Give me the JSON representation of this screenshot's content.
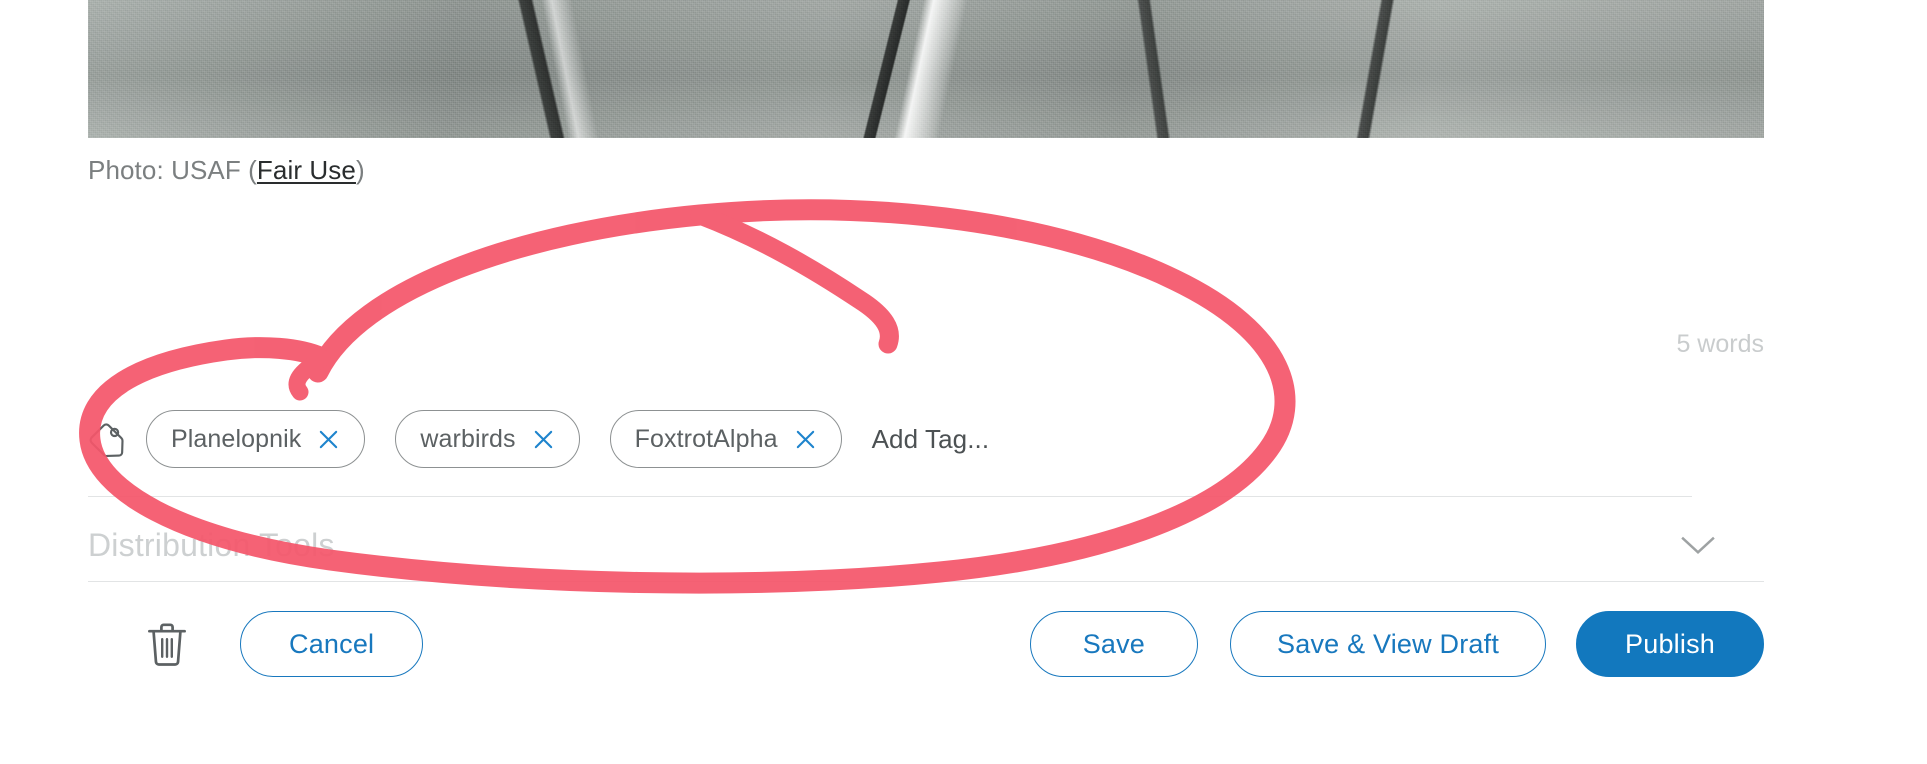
{
  "media": {
    "alt_description": "Close-up photograph of a concrete runway apron with diagonal expansion joints",
    "caption_prefix": "Photo: USAF (",
    "caption_link": "Fair Use",
    "caption_suffix": ")"
  },
  "editor": {
    "word_count": "5 words"
  },
  "tags": {
    "icon": "tag-icon",
    "items": [
      {
        "label": "Planelopnik",
        "remove_icon": "close-icon"
      },
      {
        "label": "warbirds",
        "remove_icon": "close-icon"
      },
      {
        "label": "FoxtrotAlpha",
        "remove_icon": "close-icon"
      }
    ],
    "add_placeholder": "Add Tag..."
  },
  "distribution": {
    "title": "Distribution Tools",
    "toggle_icon": "chevron-down-icon"
  },
  "actions": {
    "delete_icon": "trash-icon",
    "cancel_label": "Cancel",
    "save_label": "Save",
    "save_view_draft_label": "Save & View Draft",
    "publish_label": "Publish"
  },
  "annotation": {
    "kind": "hand-drawn-ellipse-highlight",
    "target": "tags-row",
    "color": "#f4566a"
  },
  "colors": {
    "accent_blue": "#1278be",
    "link_blue": "#1878be",
    "annotation_red": "#f4566a",
    "muted_text": "#7b7f80",
    "faint_text": "#cdd0d1",
    "chip_border": "#8d9192",
    "divider": "#e2e4e5"
  }
}
